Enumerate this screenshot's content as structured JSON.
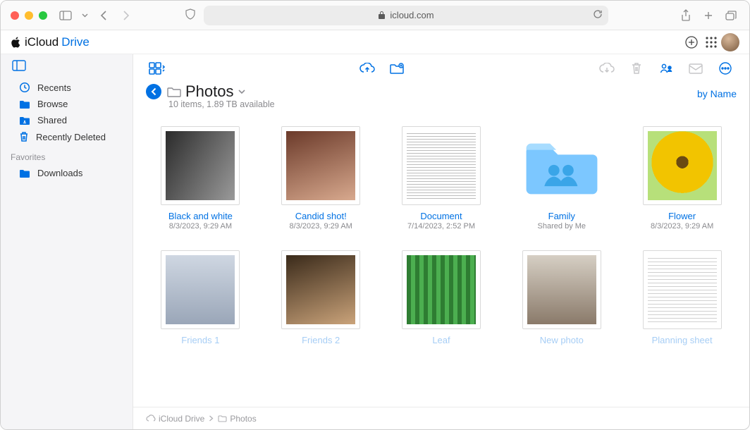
{
  "browser": {
    "url": "icloud.com"
  },
  "brand": {
    "icloud": "iCloud",
    "drive": "Drive"
  },
  "sidebar": {
    "items": [
      {
        "label": "Recents",
        "icon": "clock-icon"
      },
      {
        "label": "Browse",
        "icon": "folder-icon"
      },
      {
        "label": "Shared",
        "icon": "shared-icon"
      },
      {
        "label": "Recently Deleted",
        "icon": "trash-icon"
      }
    ],
    "favorites_heading": "Favorites",
    "favorites": [
      {
        "label": "Downloads"
      }
    ]
  },
  "folder": {
    "title": "Photos",
    "subtitle": "10 items, 1.89 TB available",
    "sort_label": "by Name"
  },
  "items": [
    {
      "name": "Black and white",
      "meta": "8/3/2023, 9:29 AM",
      "thumb": "ph-bw"
    },
    {
      "name": "Candid shot!",
      "meta": "8/3/2023, 9:29 AM",
      "thumb": "ph-candid"
    },
    {
      "name": "Document",
      "meta": "7/14/2023, 2:52 PM",
      "thumb": "ph-doc"
    },
    {
      "name": "Family",
      "meta": "Shared by Me",
      "thumb": "folder"
    },
    {
      "name": "Flower",
      "meta": "8/3/2023, 9:29 AM",
      "thumb": "ph-flower"
    },
    {
      "name": "Friends 1",
      "meta": "",
      "thumb": "ph-friends1",
      "faded": true
    },
    {
      "name": "Friends 2",
      "meta": "",
      "thumb": "ph-friends2",
      "faded": true
    },
    {
      "name": "Leaf",
      "meta": "",
      "thumb": "ph-leaf",
      "faded": true
    },
    {
      "name": "New photo",
      "meta": "",
      "thumb": "ph-new",
      "faded": true
    },
    {
      "name": "Planning sheet",
      "meta": "",
      "thumb": "ph-sheet",
      "faded": true
    }
  ],
  "breadcrumb": {
    "root": "iCloud Drive",
    "current": "Photos"
  }
}
